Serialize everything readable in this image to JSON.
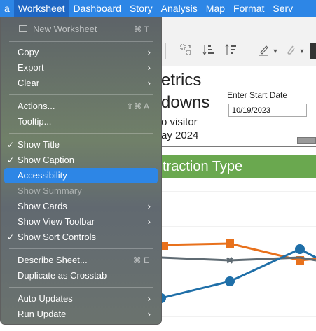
{
  "menubar": {
    "items": [
      "a",
      "Worksheet",
      "Dashboard",
      "Story",
      "Analysis",
      "Map",
      "Format",
      "Serv"
    ]
  },
  "dashboard": {
    "title_line1": "etrics",
    "title_line2": "downs",
    "subtitle_line1": "o visitor",
    "subtitle_line2": "ay 2024",
    "start_date_label": "Enter Start Date",
    "start_date_value": "10/19/2023",
    "banner": "traction Type"
  },
  "worksheet_menu": {
    "new_worksheet": {
      "label": "New Worksheet",
      "shortcut": "⌘ T"
    },
    "copy": "Copy",
    "export": "Export",
    "clear": "Clear",
    "actions": {
      "label": "Actions...",
      "shortcut": "⇧⌘ A"
    },
    "tooltip": "Tooltip...",
    "show_title": "Show Title",
    "show_caption": "Show Caption",
    "accessibility": "Accessibility",
    "show_summary": "Show Summary",
    "show_cards": "Show Cards",
    "show_view_toolbar": "Show View Toolbar",
    "show_sort_controls": "Show Sort Controls",
    "describe_sheet": {
      "label": "Describe Sheet...",
      "shortcut": "⌘ E"
    },
    "duplicate_crosstab": "Duplicate as Crosstab",
    "auto_updates": "Auto Updates",
    "run_update": "Run Update"
  },
  "colors": {
    "menubar_blue": "#2d86e6",
    "highlight_blue": "#2d86e6",
    "banner_green": "#6aa84f",
    "series_orange": "#e8711c",
    "series_gray": "#5f6b73",
    "series_blue": "#1f6fa8"
  }
}
